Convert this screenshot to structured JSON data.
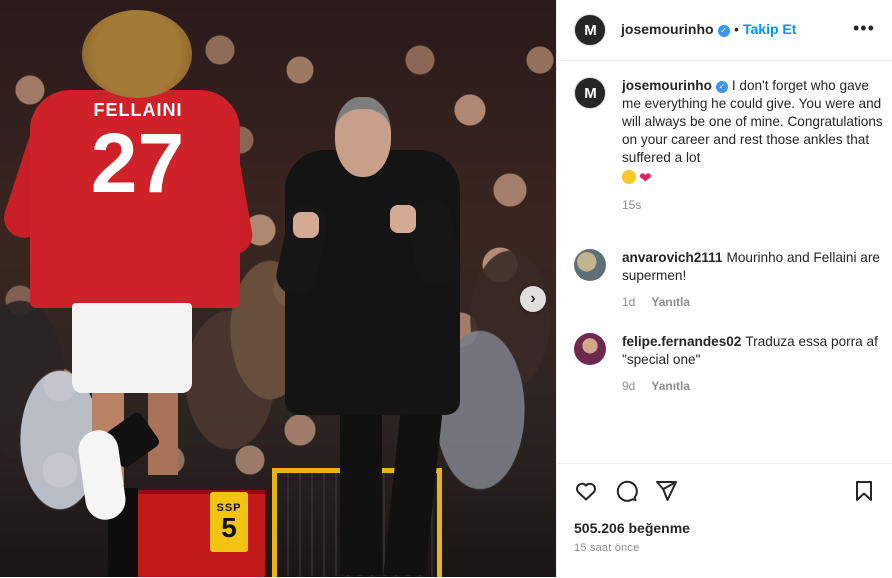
{
  "post": {
    "author": "josemourinho",
    "follow_label": "Takip Et",
    "separator": "•",
    "more_label": "•••",
    "avatar_text": "M",
    "verified_glyph": "✓",
    "likes_count": "505.206",
    "likes_label": "beğenme",
    "time_ago": "15 saat önce"
  },
  "photo": {
    "jersey_name": "FELLAINI",
    "jersey_number": "27",
    "seat_code": "SSP",
    "seat_number": "5",
    "next_glyph": "›"
  },
  "caption": {
    "user": "josemourinho",
    "text": "I don't forget who gave me everything he could give. You were and will always be one of mine. Congratulations on your career and rest those ankles that suffered a lot",
    "emojis": [
      "smiling-face-emoji",
      "red-heart-emoji"
    ],
    "heart_glyph": "❤",
    "time": "15s"
  },
  "comments": [
    {
      "user": "anvarovich2111",
      "text": "Mourinho and Fellaini are supermen!",
      "time": "1d",
      "reply_label": "Yanıtla"
    },
    {
      "user": "felipe.fernandes02",
      "text": "Traduza essa porra af \"special one\"",
      "time": "9d",
      "reply_label": "Yanıtla"
    }
  ],
  "icons": {
    "like": "heart-outline-icon",
    "comment": "comment-bubble-icon",
    "share": "paper-plane-icon",
    "save": "bookmark-icon"
  },
  "colors": {
    "link_blue": "#0095f6",
    "verified_blue": "#3897f0",
    "text": "#262626",
    "muted": "#8e8e8e",
    "border": "#efefef"
  }
}
